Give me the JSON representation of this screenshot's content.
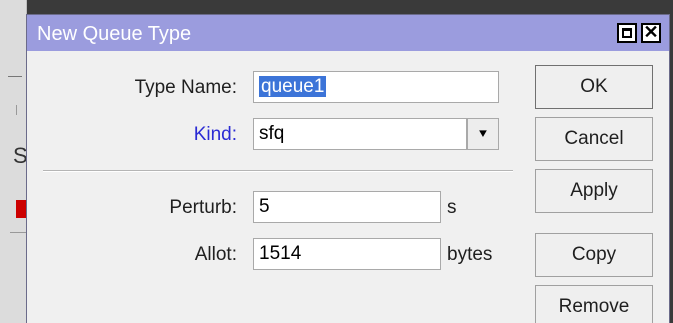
{
  "window": {
    "title": "New Queue Type"
  },
  "form": {
    "type_name_label": "Type Name:",
    "type_name_value": "queue1",
    "kind_label": "Kind:",
    "kind_value": "sfq",
    "perturb_label": "Perturb:",
    "perturb_value": "5",
    "perturb_unit": "s",
    "allot_label": "Allot:",
    "allot_value": "1514",
    "allot_unit": "bytes"
  },
  "buttons": {
    "ok": "OK",
    "cancel": "Cancel",
    "apply": "Apply",
    "copy": "Copy",
    "remove": "Remove"
  },
  "colors": {
    "titlebar": "#9b9cde",
    "kind_label": "#2b2bd4",
    "selection": "#3c74d8"
  }
}
